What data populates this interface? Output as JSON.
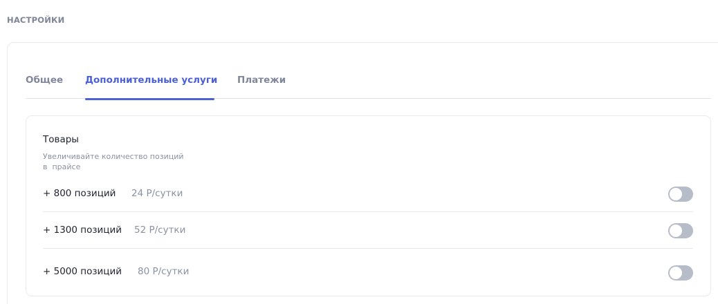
{
  "page": {
    "title": "НАСТРОЙКИ"
  },
  "tabs": [
    {
      "label": "Общее",
      "active": false
    },
    {
      "label": "Дополнительные услуги",
      "active": true
    },
    {
      "label": "Платежи",
      "active": false
    }
  ],
  "section": {
    "title": "Товары",
    "description_line1": "Увеличивайте количество позиций",
    "description_line2": "в  прайсе"
  },
  "options": [
    {
      "label": "+ 800 позиций",
      "price": "24 Р/сутки",
      "enabled": false
    },
    {
      "label": "+ 1300 позиций",
      "price": "52 Р/сутки",
      "enabled": false
    },
    {
      "label": "+ 5000 позиций",
      "price": "80 Р/сутки",
      "enabled": false
    }
  ],
  "colors": {
    "accent": "#4b5fd6",
    "muted_text": "#8a91a3",
    "toggle_off": "#b7bcc9"
  }
}
